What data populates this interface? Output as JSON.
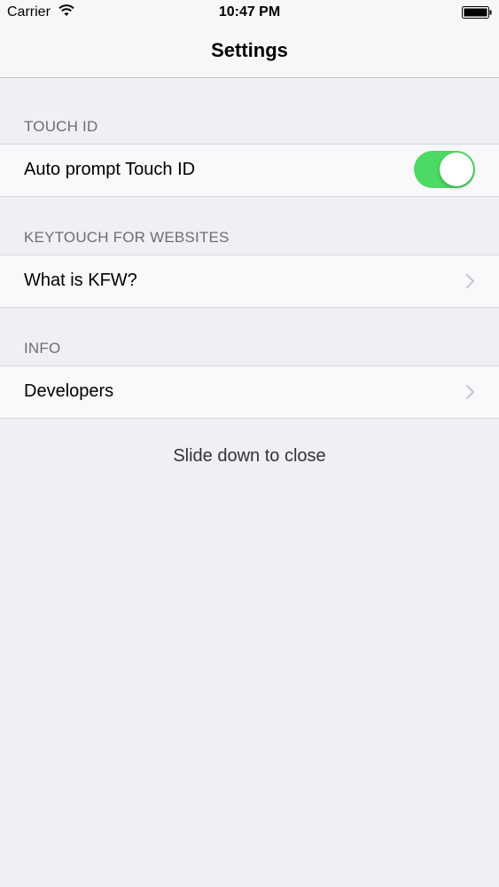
{
  "status_bar": {
    "carrier": "Carrier",
    "time": "10:47 PM",
    "icons": [
      "wifi-icon",
      "battery-icon"
    ]
  },
  "nav": {
    "title": "Settings"
  },
  "sections": [
    {
      "header": "TOUCH ID",
      "rows": [
        {
          "label": "Auto prompt Touch ID",
          "control": "toggle",
          "toggle_on": true
        }
      ]
    },
    {
      "header": "KEYTOUCH FOR WEBSITES",
      "rows": [
        {
          "label": "What is KFW?",
          "control": "chevron-right-icon"
        }
      ]
    },
    {
      "header": "INFO",
      "rows": [
        {
          "label": "Developers",
          "control": "chevron-right-icon"
        }
      ]
    }
  ],
  "footer": {
    "hint": "Slide down to close"
  },
  "colors": {
    "background": "#efeff4",
    "toggle_on": "#4cd964",
    "section_header": "#6d6d72",
    "chevron": "#c7c7cc"
  }
}
